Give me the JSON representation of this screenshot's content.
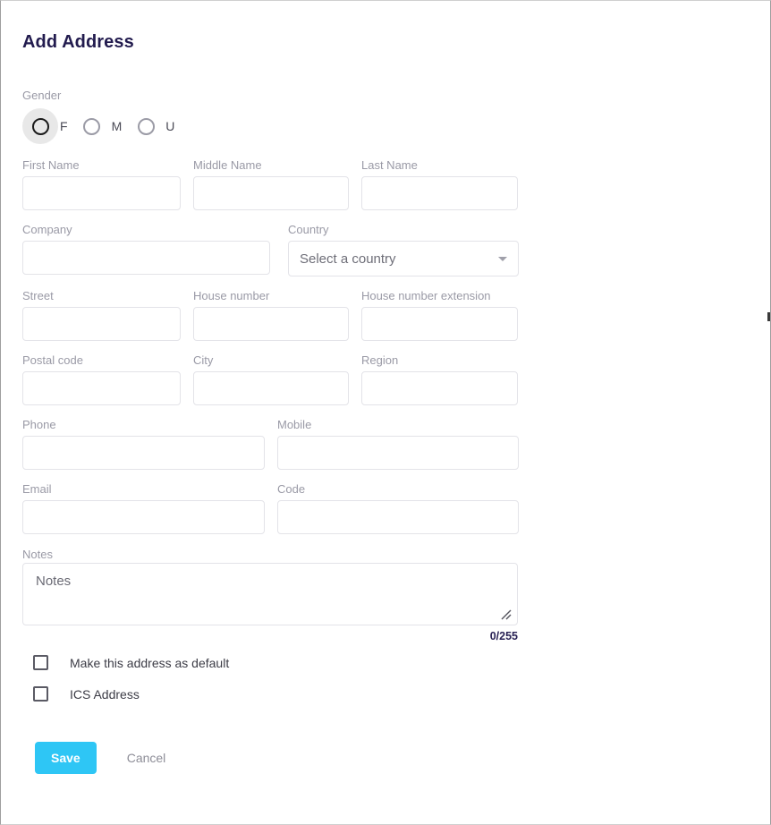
{
  "form": {
    "title": "Add Address",
    "gender": {
      "label": "Gender",
      "options": [
        {
          "value": "F",
          "label": "F",
          "selected": false,
          "focused": true
        },
        {
          "value": "M",
          "label": "M",
          "selected": false,
          "focused": false
        },
        {
          "value": "U",
          "label": "U",
          "selected": false,
          "focused": false
        }
      ]
    },
    "fields": {
      "first_name": {
        "label": "First Name",
        "value": "",
        "placeholder": ""
      },
      "middle_name": {
        "label": "Middle Name",
        "value": "",
        "placeholder": ""
      },
      "last_name": {
        "label": "Last Name",
        "value": "",
        "placeholder": ""
      },
      "company": {
        "label": "Company",
        "value": "",
        "placeholder": ""
      },
      "country": {
        "label": "Country",
        "value": "",
        "placeholder": "Select a country"
      },
      "street": {
        "label": "Street",
        "value": "",
        "placeholder": ""
      },
      "house_number": {
        "label": "House number",
        "value": "",
        "placeholder": ""
      },
      "house_number_extension": {
        "label": "House number extension",
        "value": "",
        "placeholder": ""
      },
      "postal_code": {
        "label": "Postal code",
        "value": "",
        "placeholder": ""
      },
      "city": {
        "label": "City",
        "value": "",
        "placeholder": ""
      },
      "region": {
        "label": "Region",
        "value": "",
        "placeholder": ""
      },
      "phone": {
        "label": "Phone",
        "value": "",
        "placeholder": ""
      },
      "mobile": {
        "label": "Mobile",
        "value": "",
        "placeholder": ""
      },
      "email": {
        "label": "Email",
        "value": "",
        "placeholder": ""
      },
      "code": {
        "label": "Code",
        "value": "",
        "placeholder": ""
      },
      "notes": {
        "label": "Notes",
        "value": "",
        "placeholder": "Notes",
        "counter": "0/255"
      }
    },
    "checkboxes": [
      {
        "label": "Make this address as default",
        "checked": false
      },
      {
        "label": "ICS Address",
        "checked": false
      }
    ],
    "buttons": {
      "save": "Save",
      "cancel": "Cancel"
    }
  },
  "colors": {
    "title": "#221b4e",
    "accent": "#2ec6f5",
    "label": "#9a9aa6",
    "border": "#e3e3e8",
    "counter": "#2a2356"
  }
}
